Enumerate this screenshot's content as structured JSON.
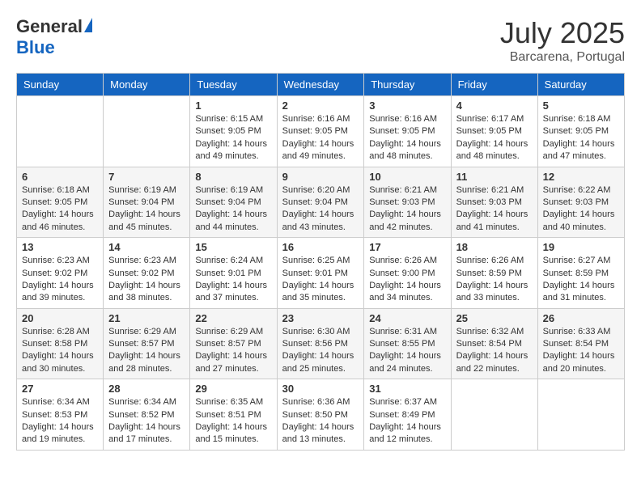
{
  "logo": {
    "general": "General",
    "blue": "Blue"
  },
  "title": {
    "month_year": "July 2025",
    "location": "Barcarena, Portugal"
  },
  "headers": [
    "Sunday",
    "Monday",
    "Tuesday",
    "Wednesday",
    "Thursday",
    "Friday",
    "Saturday"
  ],
  "weeks": [
    [
      {
        "day": "",
        "info": ""
      },
      {
        "day": "",
        "info": ""
      },
      {
        "day": "1",
        "info": "Sunrise: 6:15 AM\nSunset: 9:05 PM\nDaylight: 14 hours and 49 minutes."
      },
      {
        "day": "2",
        "info": "Sunrise: 6:16 AM\nSunset: 9:05 PM\nDaylight: 14 hours and 49 minutes."
      },
      {
        "day": "3",
        "info": "Sunrise: 6:16 AM\nSunset: 9:05 PM\nDaylight: 14 hours and 48 minutes."
      },
      {
        "day": "4",
        "info": "Sunrise: 6:17 AM\nSunset: 9:05 PM\nDaylight: 14 hours and 48 minutes."
      },
      {
        "day": "5",
        "info": "Sunrise: 6:18 AM\nSunset: 9:05 PM\nDaylight: 14 hours and 47 minutes."
      }
    ],
    [
      {
        "day": "6",
        "info": "Sunrise: 6:18 AM\nSunset: 9:05 PM\nDaylight: 14 hours and 46 minutes."
      },
      {
        "day": "7",
        "info": "Sunrise: 6:19 AM\nSunset: 9:04 PM\nDaylight: 14 hours and 45 minutes."
      },
      {
        "day": "8",
        "info": "Sunrise: 6:19 AM\nSunset: 9:04 PM\nDaylight: 14 hours and 44 minutes."
      },
      {
        "day": "9",
        "info": "Sunrise: 6:20 AM\nSunset: 9:04 PM\nDaylight: 14 hours and 43 minutes."
      },
      {
        "day": "10",
        "info": "Sunrise: 6:21 AM\nSunset: 9:03 PM\nDaylight: 14 hours and 42 minutes."
      },
      {
        "day": "11",
        "info": "Sunrise: 6:21 AM\nSunset: 9:03 PM\nDaylight: 14 hours and 41 minutes."
      },
      {
        "day": "12",
        "info": "Sunrise: 6:22 AM\nSunset: 9:03 PM\nDaylight: 14 hours and 40 minutes."
      }
    ],
    [
      {
        "day": "13",
        "info": "Sunrise: 6:23 AM\nSunset: 9:02 PM\nDaylight: 14 hours and 39 minutes."
      },
      {
        "day": "14",
        "info": "Sunrise: 6:23 AM\nSunset: 9:02 PM\nDaylight: 14 hours and 38 minutes."
      },
      {
        "day": "15",
        "info": "Sunrise: 6:24 AM\nSunset: 9:01 PM\nDaylight: 14 hours and 37 minutes."
      },
      {
        "day": "16",
        "info": "Sunrise: 6:25 AM\nSunset: 9:01 PM\nDaylight: 14 hours and 35 minutes."
      },
      {
        "day": "17",
        "info": "Sunrise: 6:26 AM\nSunset: 9:00 PM\nDaylight: 14 hours and 34 minutes."
      },
      {
        "day": "18",
        "info": "Sunrise: 6:26 AM\nSunset: 8:59 PM\nDaylight: 14 hours and 33 minutes."
      },
      {
        "day": "19",
        "info": "Sunrise: 6:27 AM\nSunset: 8:59 PM\nDaylight: 14 hours and 31 minutes."
      }
    ],
    [
      {
        "day": "20",
        "info": "Sunrise: 6:28 AM\nSunset: 8:58 PM\nDaylight: 14 hours and 30 minutes."
      },
      {
        "day": "21",
        "info": "Sunrise: 6:29 AM\nSunset: 8:57 PM\nDaylight: 14 hours and 28 minutes."
      },
      {
        "day": "22",
        "info": "Sunrise: 6:29 AM\nSunset: 8:57 PM\nDaylight: 14 hours and 27 minutes."
      },
      {
        "day": "23",
        "info": "Sunrise: 6:30 AM\nSunset: 8:56 PM\nDaylight: 14 hours and 25 minutes."
      },
      {
        "day": "24",
        "info": "Sunrise: 6:31 AM\nSunset: 8:55 PM\nDaylight: 14 hours and 24 minutes."
      },
      {
        "day": "25",
        "info": "Sunrise: 6:32 AM\nSunset: 8:54 PM\nDaylight: 14 hours and 22 minutes."
      },
      {
        "day": "26",
        "info": "Sunrise: 6:33 AM\nSunset: 8:54 PM\nDaylight: 14 hours and 20 minutes."
      }
    ],
    [
      {
        "day": "27",
        "info": "Sunrise: 6:34 AM\nSunset: 8:53 PM\nDaylight: 14 hours and 19 minutes."
      },
      {
        "day": "28",
        "info": "Sunrise: 6:34 AM\nSunset: 8:52 PM\nDaylight: 14 hours and 17 minutes."
      },
      {
        "day": "29",
        "info": "Sunrise: 6:35 AM\nSunset: 8:51 PM\nDaylight: 14 hours and 15 minutes."
      },
      {
        "day": "30",
        "info": "Sunrise: 6:36 AM\nSunset: 8:50 PM\nDaylight: 14 hours and 13 minutes."
      },
      {
        "day": "31",
        "info": "Sunrise: 6:37 AM\nSunset: 8:49 PM\nDaylight: 14 hours and 12 minutes."
      },
      {
        "day": "",
        "info": ""
      },
      {
        "day": "",
        "info": ""
      }
    ]
  ]
}
